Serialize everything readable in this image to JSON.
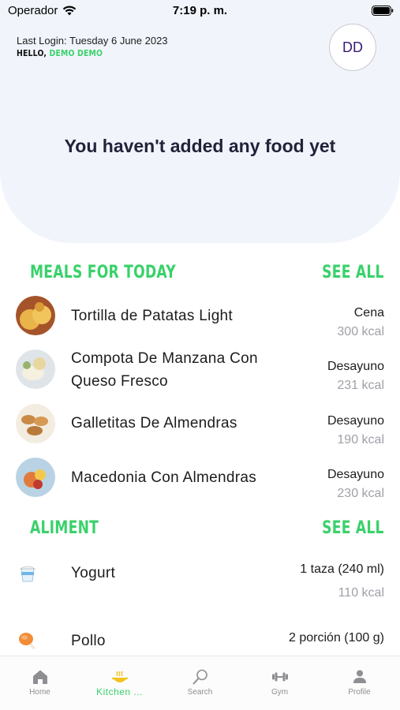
{
  "status_bar": {
    "carrier": "Operador",
    "time": "7:19 p. m."
  },
  "header": {
    "last_login": "Last Login: Tuesday 6 June 2023",
    "hello_prefix": "HELLO,",
    "user_name": "DEMO DEMO",
    "avatar_initials": "DD",
    "empty_message": "You haven't added any food yet"
  },
  "meals": {
    "title": "MEALS FOR TODAY",
    "see_all": "SEE ALL",
    "items": [
      {
        "name": "Tortilla de Patatas Light",
        "meal": "Cena",
        "kcal": "300 kcal"
      },
      {
        "name": "Compota De Manzana Con Queso Fresco",
        "meal": "Desayuno",
        "kcal": "231 kcal"
      },
      {
        "name": "Galletitas De Almendras",
        "meal": "Desayuno",
        "kcal": "190 kcal"
      },
      {
        "name": "Macedonia Con Almendras",
        "meal": "Desayuno",
        "kcal": "230 kcal"
      }
    ]
  },
  "aliments": {
    "title": "ALIMENT",
    "see_all": "SEE ALL",
    "items": [
      {
        "name": "Yogurt",
        "portion": "1 taza (240 ml)",
        "kcal": "110 kcal",
        "icon": "yogurt-icon"
      },
      {
        "name": "Pollo",
        "portion": "2 porción (100 g)",
        "icon": "chicken-icon"
      }
    ]
  },
  "tabs": [
    {
      "label": "Home",
      "icon": "home-icon"
    },
    {
      "label": "Kitchen ...",
      "icon": "kitchen-icon"
    },
    {
      "label": "Search",
      "icon": "search-icon"
    },
    {
      "label": "Gym",
      "icon": "dumbbell-icon"
    },
    {
      "label": "Profile",
      "icon": "profile-icon"
    }
  ],
  "colors": {
    "accent": "#39d16a",
    "header_bg": "#f1f5fb",
    "muted": "#a0a0a8"
  }
}
